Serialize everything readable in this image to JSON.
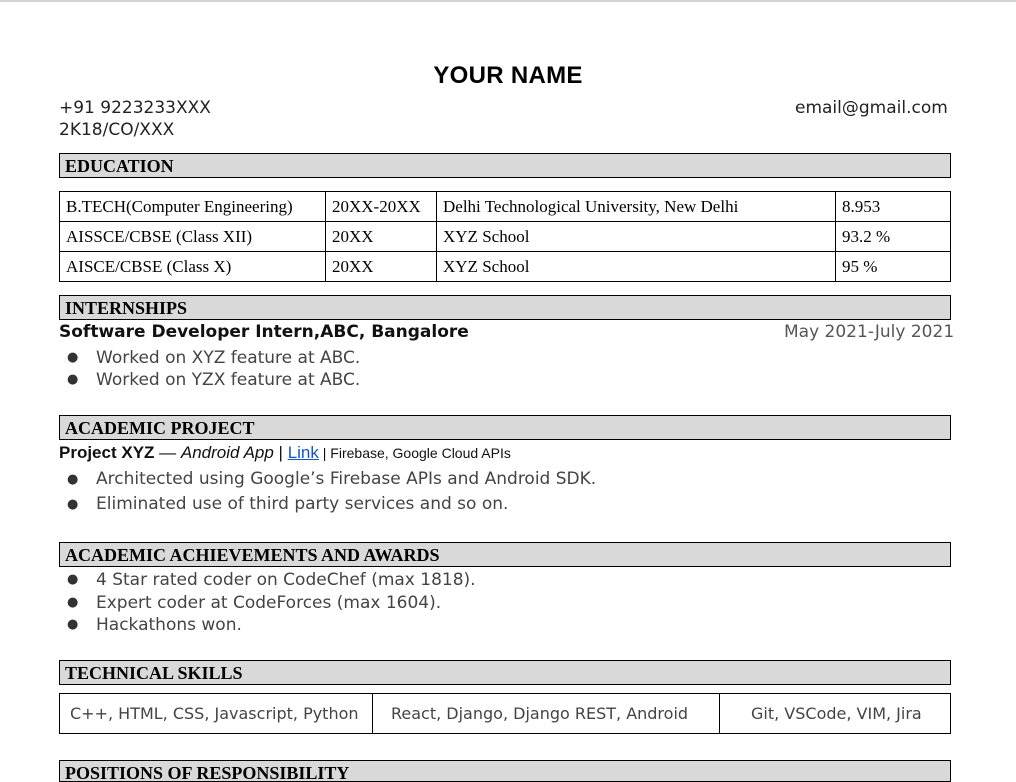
{
  "header": {
    "name": "YOUR NAME",
    "phone": "+91 9223233XXX",
    "roll": "2K18/CO/XXX",
    "email": "email@gmail.com"
  },
  "sections": {
    "education": "EDUCATION",
    "internships": "INTERNSHIPS",
    "project": "ACADEMIC PROJECT",
    "achievements": "ACADEMIC ACHIEVEMENTS AND AWARDS",
    "skills": "TECHNICAL SKILLS",
    "positions": "POSITIONS OF RESPONSIBILITY"
  },
  "education": [
    {
      "degree": "B.TECH(Computer Engineering)",
      "years": "20XX-20XX",
      "institute": "Delhi Technological University, New Delhi",
      "score": "8.953"
    },
    {
      "degree": "AISSCE/CBSE (Class XII)",
      "years": "20XX",
      "institute": "XYZ School",
      "score": "93.2 %"
    },
    {
      "degree": "AISCE/CBSE (Class X)",
      "years": "20XX",
      "institute": "XYZ School",
      "score": "95 %"
    }
  ],
  "internship": {
    "role": "Software Developer Intern,ABC, Bangalore",
    "date": "May 2021-July 2021",
    "bullets": [
      "Worked on XYZ feature at ABC.",
      "Worked on YZX feature at ABC."
    ]
  },
  "project": {
    "name": "Project XYZ",
    "dash": " — ",
    "type": "Android App",
    "sep1": " | ",
    "link": "Link",
    "sep2": " | ",
    "tech": "Firebase, Google Cloud APIs",
    "bullets": [
      "Architected using Google’s Firebase APIs and Android SDK.",
      "Eliminated use of third party services and so on."
    ]
  },
  "achievements": [
    "4 Star rated coder on CodeChef (max 1818).",
    "Expert coder at CodeForces (max 1604).",
    "Hackathons won."
  ],
  "skills": [
    "C++, HTML, CSS, Javascript, Python",
    "React, Django, Django REST, Android",
    "Git, VSCode, VIM, Jira"
  ]
}
